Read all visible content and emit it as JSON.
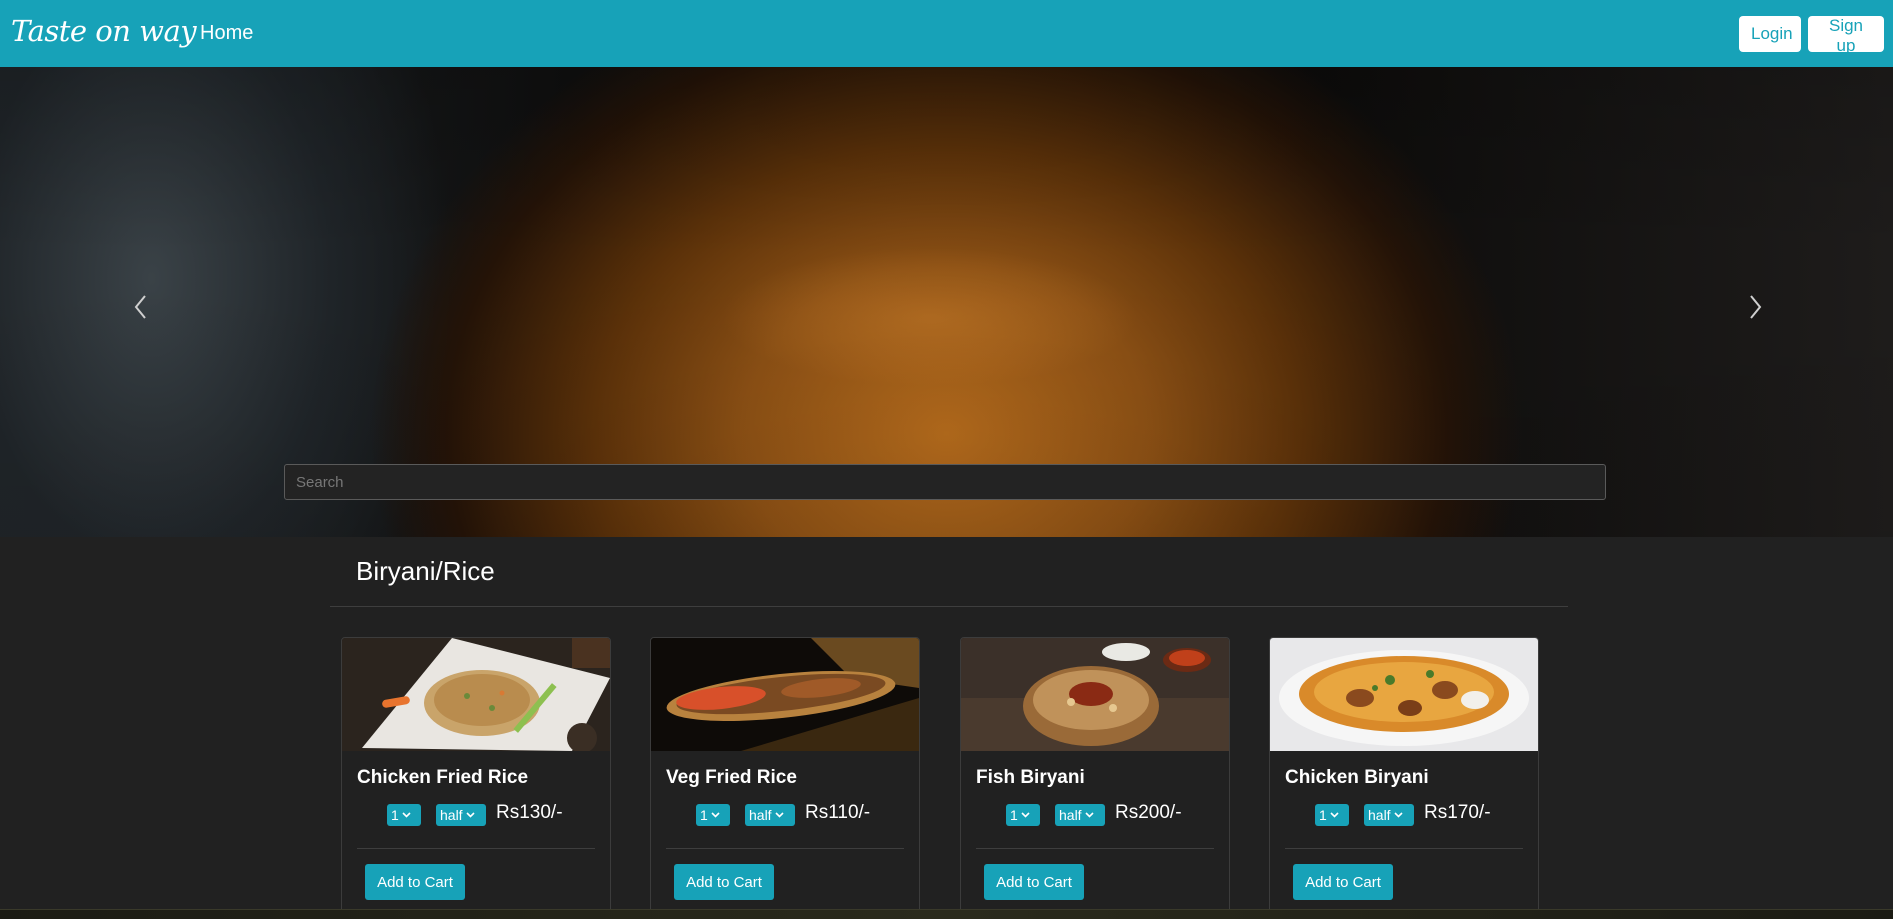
{
  "navbar": {
    "brand": "Taste on way",
    "home_label": "Home",
    "login_label": "Login",
    "signup_label": "Sign up",
    "accent_color": "#17a2b8"
  },
  "hero": {
    "prev_icon": "chevron-left-icon",
    "next_icon": "chevron-right-icon",
    "search": {
      "placeholder": "Search",
      "value": ""
    }
  },
  "section": {
    "title": "Biryani/Rice"
  },
  "cards": [
    {
      "title": "Chicken Fried Rice",
      "qty": "1",
      "size": "half",
      "price": "Rs130/-",
      "add_label": "Add to Cart"
    },
    {
      "title": "Veg Fried Rice",
      "qty": "1",
      "size": "half",
      "price": "Rs110/-",
      "add_label": "Add to Cart"
    },
    {
      "title": "Fish Biryani",
      "qty": "1",
      "size": "half",
      "price": "Rs200/-",
      "add_label": "Add to Cart"
    },
    {
      "title": "Chicken Biryani",
      "qty": "1",
      "size": "half",
      "price": "Rs170/-",
      "add_label": "Add to Cart"
    }
  ]
}
